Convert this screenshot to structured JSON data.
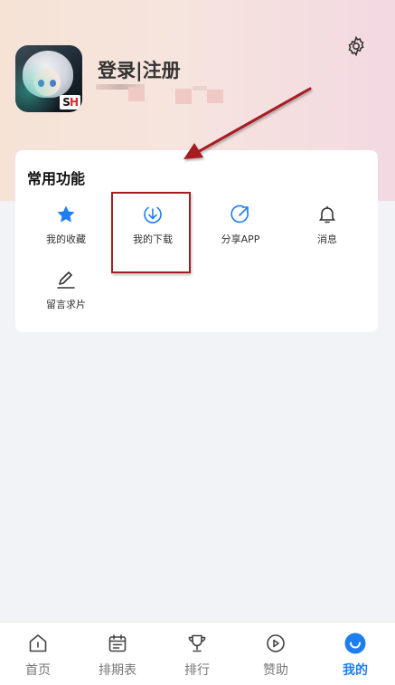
{
  "header": {
    "login_label": "登录|注册",
    "settings_icon": "gear-icon",
    "avatar_logo_text_a": "S",
    "avatar_logo_text_b": "H"
  },
  "card": {
    "title": "常用功能",
    "items": [
      {
        "label": "我的收藏",
        "icon": "star-icon"
      },
      {
        "label": "我的下载",
        "icon": "download-icon"
      },
      {
        "label": "分享APP",
        "icon": "share-icon"
      },
      {
        "label": "消息",
        "icon": "bell-icon"
      },
      {
        "label": "留言求片",
        "icon": "pencil-icon"
      }
    ]
  },
  "bottom_nav": {
    "items": [
      {
        "label": "首页",
        "icon": "home-icon",
        "active": false
      },
      {
        "label": "排期表",
        "icon": "calendar-icon",
        "active": false
      },
      {
        "label": "排行",
        "icon": "trophy-icon",
        "active": false
      },
      {
        "label": "赞助",
        "icon": "play-circle-icon",
        "active": false
      },
      {
        "label": "我的",
        "icon": "profile-smile-icon",
        "active": true
      }
    ]
  },
  "colors": {
    "accent": "#1e7ef0",
    "annotation": "#a51d22",
    "header_gradient_left": "#f6e3d6",
    "header_gradient_right": "#f3d9e2",
    "background": "#f2f3f6"
  }
}
